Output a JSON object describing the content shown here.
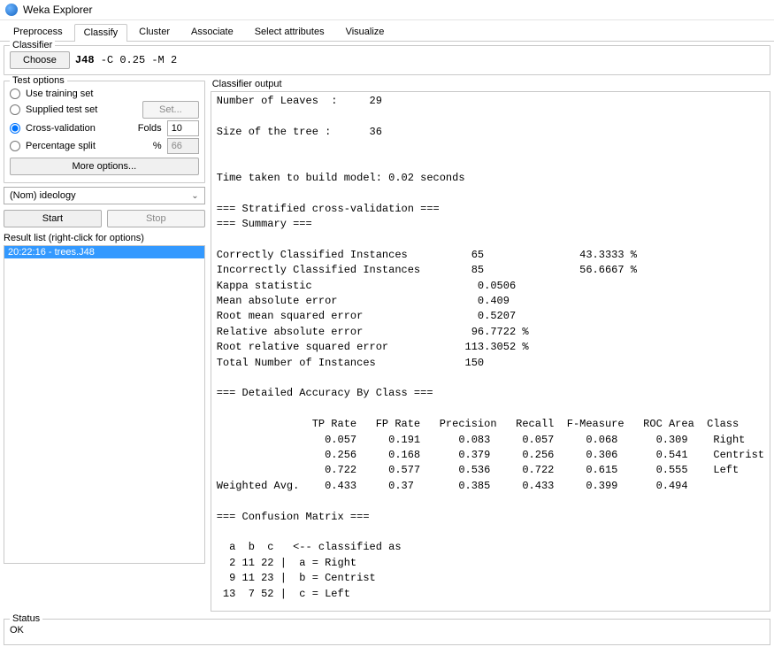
{
  "window": {
    "title": "Weka Explorer"
  },
  "tabs": {
    "items": [
      "Preprocess",
      "Classify",
      "Cluster",
      "Associate",
      "Select attributes",
      "Visualize"
    ],
    "active_index": 1
  },
  "classifier_group": {
    "title": "Classifier",
    "choose_label": "Choose",
    "scheme_name": "J48",
    "scheme_opts": " -C 0.25 -M 2"
  },
  "test_options": {
    "title": "Test options",
    "use_training_set": "Use training set",
    "supplied_test_set": "Supplied test set",
    "set_btn": "Set...",
    "cross_validation": "Cross-validation",
    "folds_label": "Folds",
    "folds_value": "10",
    "percentage_split": "Percentage split",
    "percent_label": "%",
    "percent_value": "66",
    "more_options": "More options...",
    "selected": "cross_validation"
  },
  "class_attr": {
    "display": "(Nom) ideology"
  },
  "buttons": {
    "start": "Start",
    "stop": "Stop"
  },
  "result_list": {
    "title": "Result list (right-click for options)",
    "items": [
      "20:22:16 - trees.J48"
    ],
    "selected_index": 0
  },
  "output": {
    "title": "Classifier output",
    "text": "Number of Leaves  :     29\n\nSize of the tree :      36\n\n\nTime taken to build model: 0.02 seconds\n\n=== Stratified cross-validation ===\n=== Summary ===\n\nCorrectly Classified Instances          65               43.3333 %\nIncorrectly Classified Instances        85               56.6667 %\nKappa statistic                          0.0506\nMean absolute error                      0.409 \nRoot mean squared error                  0.5207\nRelative absolute error                 96.7722 %\nRoot relative squared error            113.3052 %\nTotal Number of Instances              150     \n\n=== Detailed Accuracy By Class ===\n\n               TP Rate   FP Rate   Precision   Recall  F-Measure   ROC Area  Class\n                 0.057     0.191      0.083     0.057     0.068      0.309    Right\n                 0.256     0.168      0.379     0.256     0.306      0.541    Centrist\n                 0.722     0.577      0.536     0.722     0.615      0.555    Left\nWeighted Avg.    0.433     0.37       0.385     0.433     0.399      0.494\n\n=== Confusion Matrix ===\n\n  a  b  c   <-- classified as\n  2 11 22 |  a = Right\n  9 11 23 |  b = Centrist\n 13  7 52 |  c = Left\n"
  },
  "status": {
    "title": "Status",
    "text": "OK"
  }
}
